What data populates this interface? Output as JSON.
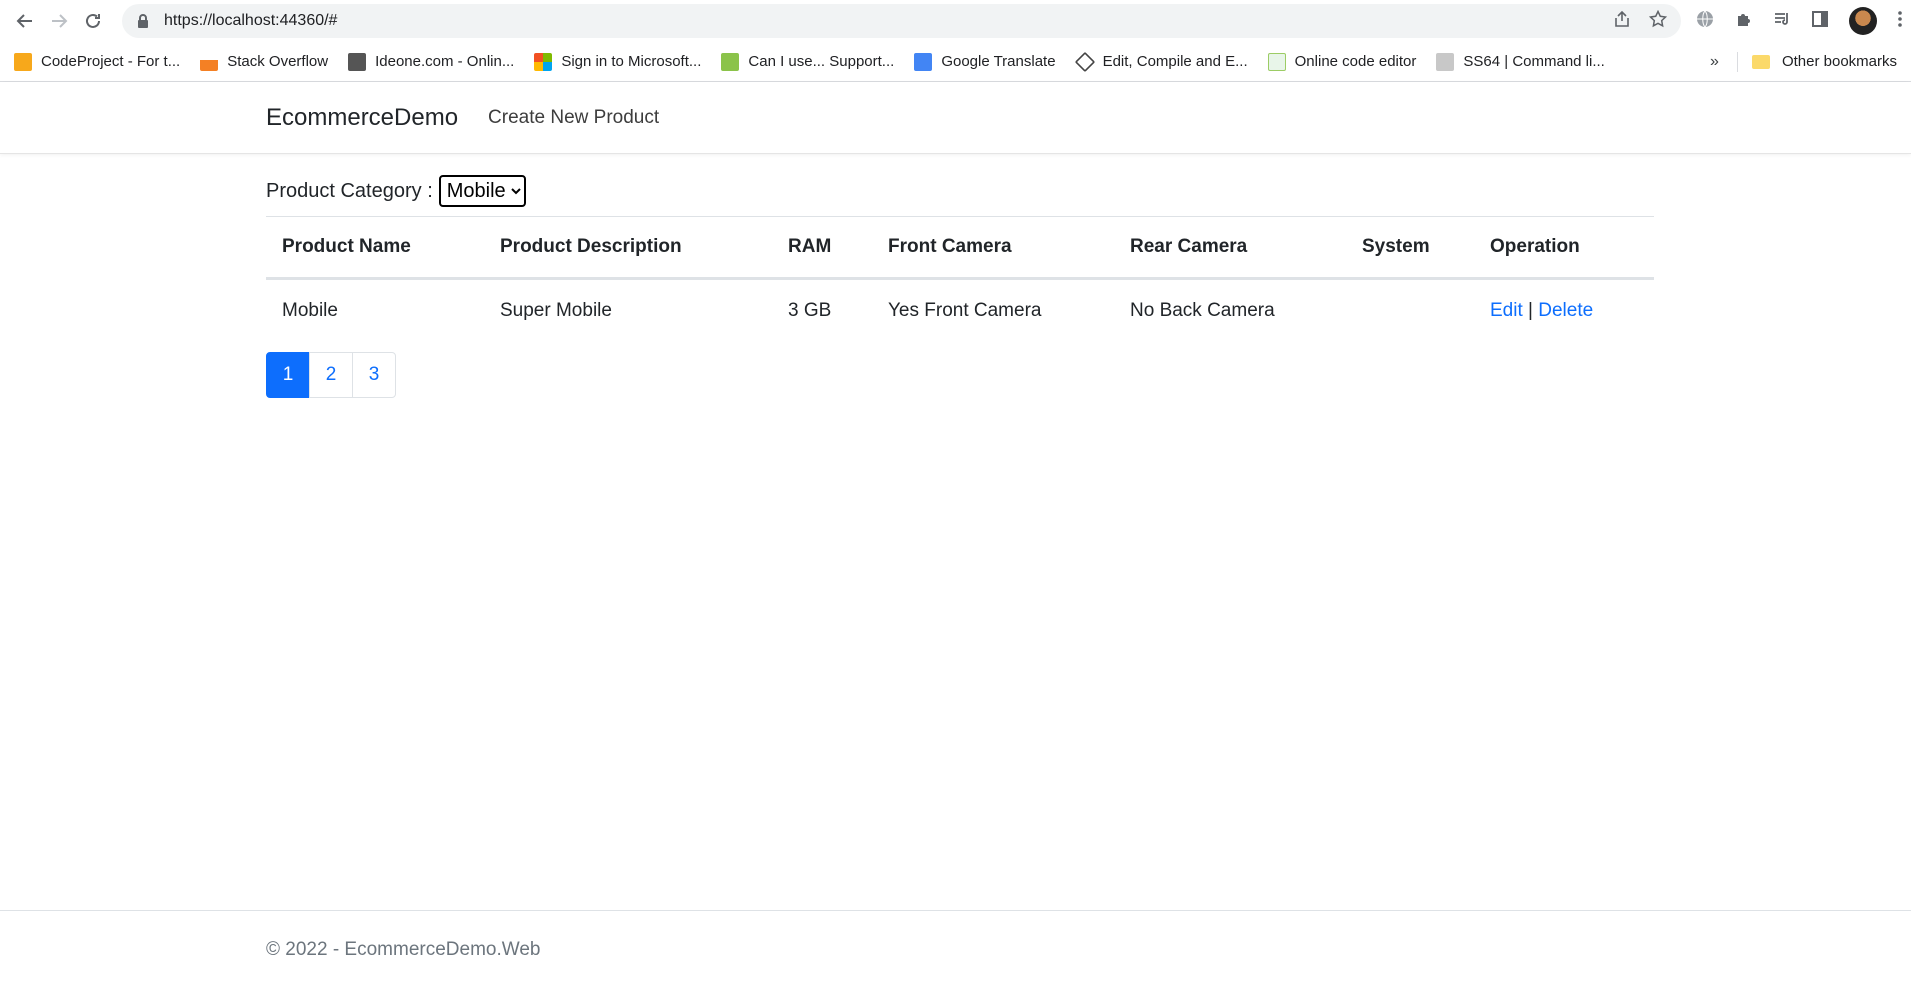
{
  "browser": {
    "url": "https://localhost:44360/#",
    "bookmarks": [
      {
        "label": "CodeProject - For t...",
        "color": "#f7a81b"
      },
      {
        "label": "Stack Overflow",
        "color": "#f48024"
      },
      {
        "label": "Ideone.com - Onlin...",
        "color": "#555555"
      },
      {
        "label": "Sign in to Microsoft...",
        "color": "#f25022"
      },
      {
        "label": "Can I use... Support...",
        "color": "#8bc34a"
      },
      {
        "label": "Google Translate",
        "color": "#4285f4"
      },
      {
        "label": "Edit, Compile and E...",
        "color": "#444444"
      },
      {
        "label": "Online code editor",
        "color": "#9ccc65"
      },
      {
        "label": "SS64 | Command li...",
        "color": "#c8c8c8"
      }
    ],
    "other_bookmarks": "Other bookmarks"
  },
  "app": {
    "brand": "EcommerceDemo",
    "nav_link": "Create New Product",
    "filter_label": "Product Category :",
    "category_selected": "Mobile",
    "columns": [
      "Product Name",
      "Product Description",
      "RAM",
      "Front Camera",
      "Rear Camera",
      "System",
      "Operation"
    ],
    "rows": [
      {
        "name": "Mobile",
        "description": "Super Mobile",
        "ram": "3 GB",
        "front_camera": "Yes Front Camera",
        "rear_camera": "No Back Camera",
        "system": "",
        "edit": "Edit",
        "separator": "|",
        "delete": "Delete"
      }
    ],
    "pages": [
      "1",
      "2",
      "3"
    ],
    "footer": "© 2022 - EcommerceDemo.Web"
  }
}
